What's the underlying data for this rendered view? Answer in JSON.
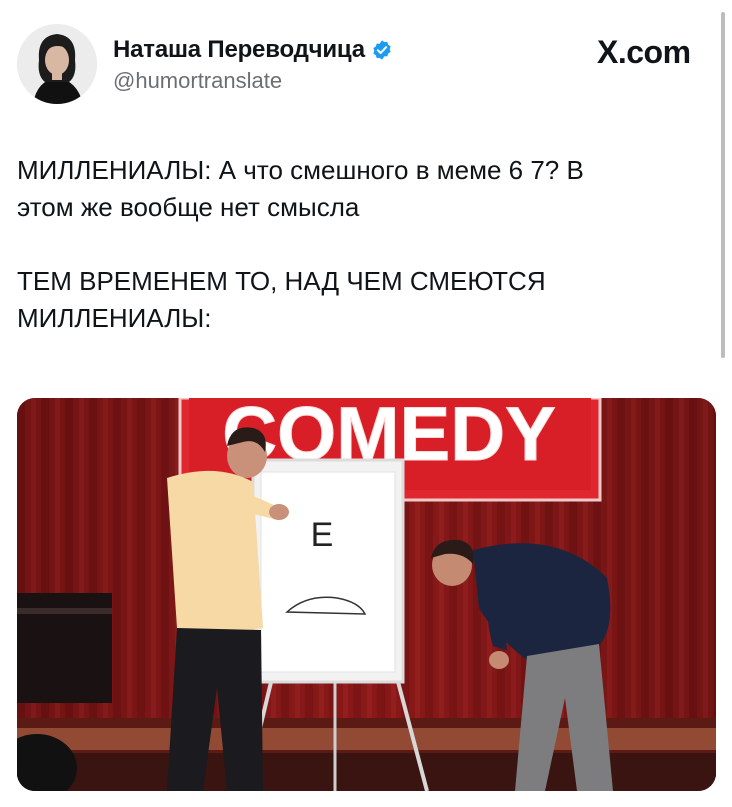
{
  "tweet": {
    "author_name": "Наташа Переводчица",
    "author_handle": "@humortranslate",
    "verified": true,
    "site_logo": "X.com",
    "text_lines_1": [
      "МИЛЛЕНИАЛЫ: А что смешного в меме 6 7? В",
      "этом же вообще нет смысла"
    ],
    "text_lines_2": [
      "ТЕМ ВРЕМЕНЕМ ТО, НАД ЧЕМ СМЕЮТСЯ",
      "МИЛЛЕНИАЛЫ:"
    ]
  },
  "media": {
    "sign_text": "COMEDY",
    "board_letter": "Е"
  },
  "colors": {
    "verified": "#1d9bf0",
    "handle": "#6b6f74",
    "stage_red": "#8c1a1a",
    "sign_red": "#d6252c"
  },
  "icons": [
    "avatar-photo",
    "verified-badge-icon",
    "x-logo-icon"
  ]
}
